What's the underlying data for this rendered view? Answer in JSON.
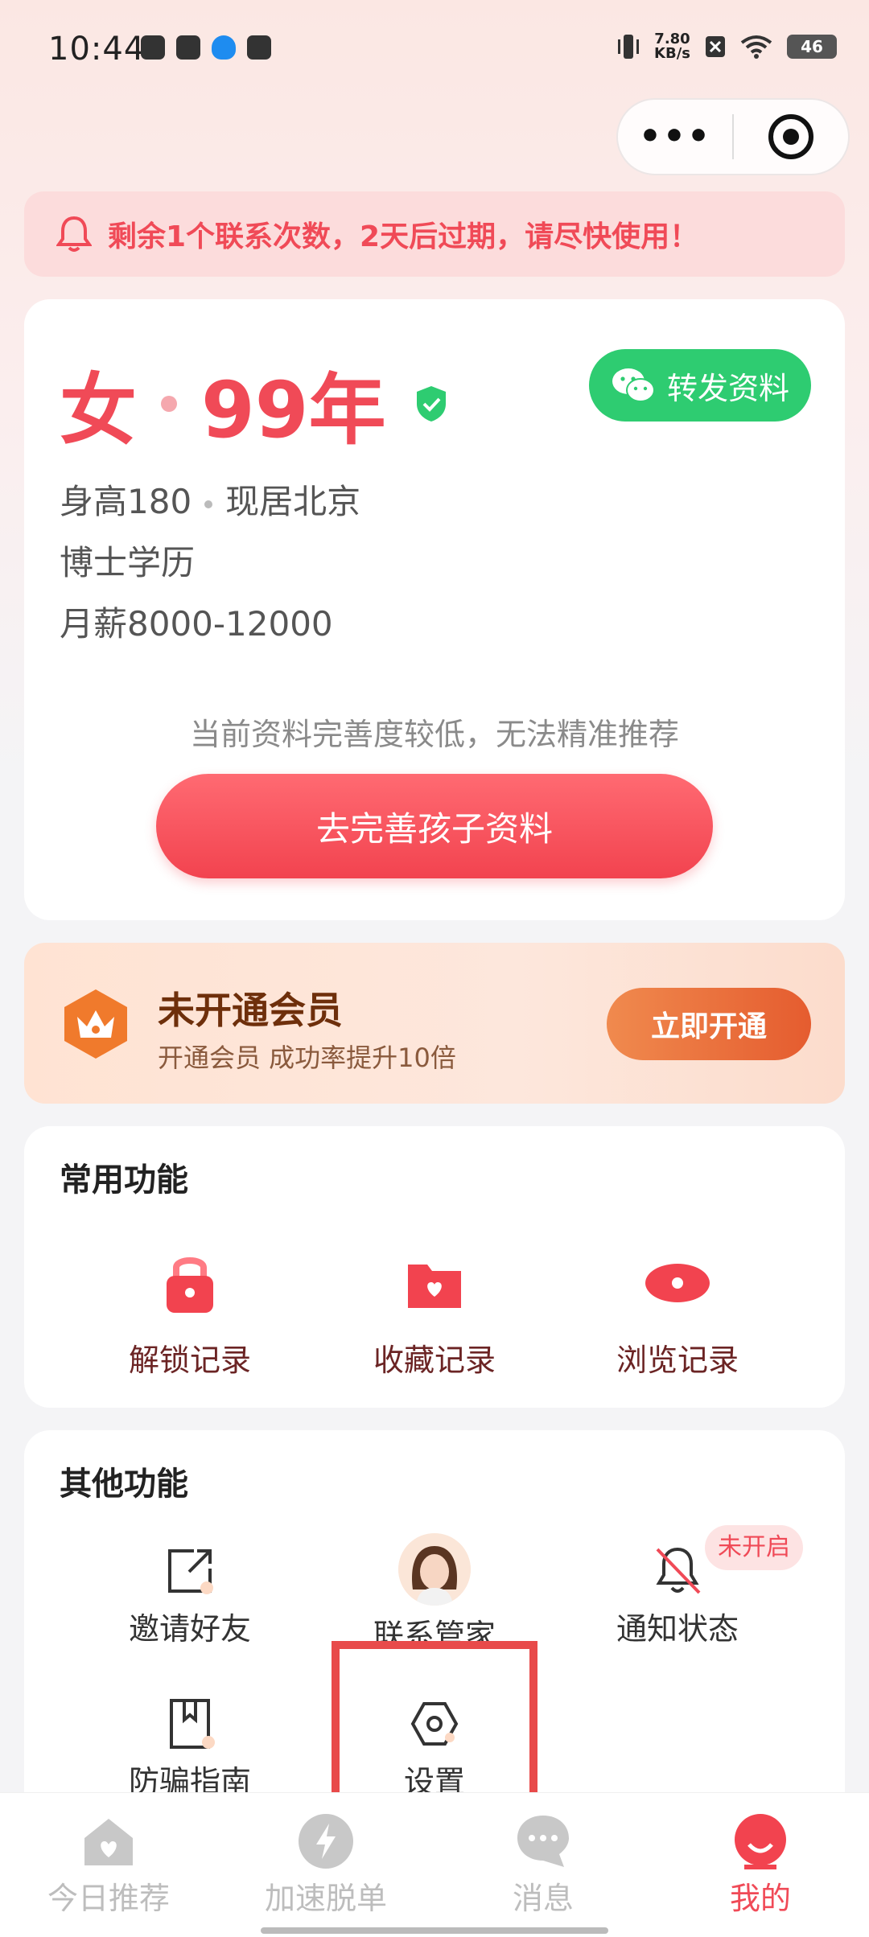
{
  "status_bar": {
    "time": "10:44",
    "net_speed_value": "7.80",
    "net_speed_unit": "KB/s",
    "battery": "46"
  },
  "notice": {
    "text": "剩余1个联系次数，2天后过期，请尽快使用！"
  },
  "profile": {
    "gender": "女",
    "year": "99年",
    "share_label": "转发资料",
    "height": "身高180",
    "residence": "现居北京",
    "education": "博士学历",
    "salary": "月薪8000-12000",
    "hint": "当前资料完善度较低，无法精准推荐",
    "complete_button": "去完善孩子资料"
  },
  "vip": {
    "title": "未开通会员",
    "subtitle": "开通会员 成功率提升10倍",
    "button": "立即开通"
  },
  "common": {
    "title": "常用功能",
    "items": [
      {
        "label": "解锁记录",
        "icon": "lock-icon"
      },
      {
        "label": "收藏记录",
        "icon": "folder-heart-icon"
      },
      {
        "label": "浏览记录",
        "icon": "eye-icon"
      }
    ]
  },
  "other": {
    "title": "其他功能",
    "items": [
      {
        "label": "邀请好友",
        "icon": "share-out-icon"
      },
      {
        "label": "联系管家",
        "icon": "avatar"
      },
      {
        "label": "通知状态",
        "icon": "bell-off-icon",
        "badge": "未开启"
      },
      {
        "label": "防骗指南",
        "icon": "bookmark-book-icon"
      },
      {
        "label": "设置",
        "icon": "settings-hex-icon"
      }
    ]
  },
  "tabs": [
    {
      "label": "今日推荐",
      "icon": "home-heart-icon",
      "active": false
    },
    {
      "label": "加速脱单",
      "icon": "lightning-icon",
      "active": false
    },
    {
      "label": "消息",
      "icon": "chat-icon",
      "active": false
    },
    {
      "label": "我的",
      "icon": "profile-icon",
      "active": true
    }
  ],
  "colors": {
    "accent": "#f04a57",
    "green": "#2ecc71",
    "vip_orange": "#e55c2f",
    "highlight": "#e84a4a"
  }
}
